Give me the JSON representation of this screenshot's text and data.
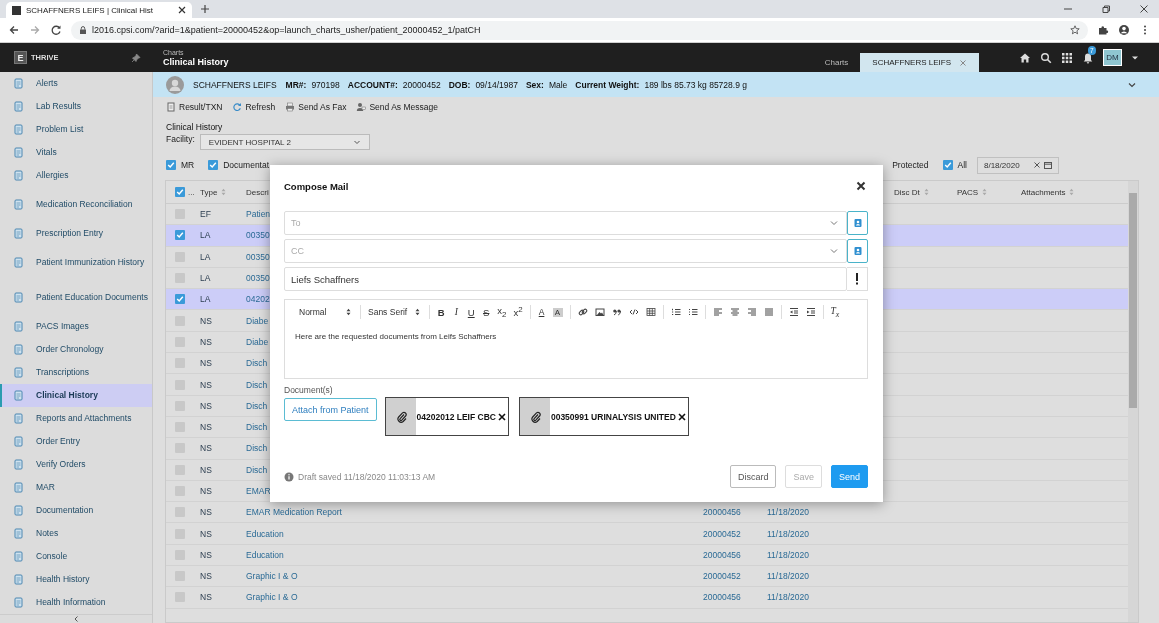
{
  "browser": {
    "tab_title": "SCHAFFNERS LEIFS | Clinical Hist",
    "url": "l2016.cpsi.com/?arid=1&patient=20000452&op=launch_charts_usher/patient_20000452_1/patCH"
  },
  "app": {
    "brand_logo": "E",
    "brand": "THRIVE",
    "breadcrumb": "Charts",
    "title": "Clinical History",
    "tabs": [
      {
        "label": "Charts",
        "selected": false
      },
      {
        "label": "SCHAFFNERS LEIFS",
        "selected": true
      }
    ],
    "notification_count": "7",
    "user_initials": "DM"
  },
  "sidebar": {
    "items": [
      {
        "label": "Alerts",
        "selected": false
      },
      {
        "label": "Lab Results",
        "selected": false
      },
      {
        "label": "Problem List",
        "selected": false
      },
      {
        "label": "Vitals",
        "selected": false
      },
      {
        "label": "Allergies",
        "selected": false
      },
      {
        "label": "Medication Reconciliation",
        "selected": false
      },
      {
        "label": "Prescription Entry",
        "selected": false
      },
      {
        "label": "Patient Immunization History",
        "selected": false
      },
      {
        "label": "Patient Education Documents",
        "selected": false
      },
      {
        "label": "PACS Images",
        "selected": false
      },
      {
        "label": "Order Chronology",
        "selected": false
      },
      {
        "label": "Transcriptions",
        "selected": false
      },
      {
        "label": "Clinical History",
        "selected": true
      },
      {
        "label": "Reports and Attachments",
        "selected": false
      },
      {
        "label": "Order Entry",
        "selected": false
      },
      {
        "label": "Verify Orders",
        "selected": false
      },
      {
        "label": "MAR",
        "selected": false
      },
      {
        "label": "Documentation",
        "selected": false
      },
      {
        "label": "Notes",
        "selected": false
      },
      {
        "label": "Console",
        "selected": false
      },
      {
        "label": "Health History",
        "selected": false
      },
      {
        "label": "Health Information",
        "selected": false
      }
    ]
  },
  "patient": {
    "name": "SCHAFFNERS LEIFS",
    "fields": [
      {
        "label": "MR#:",
        "value": "970198"
      },
      {
        "label": "ACCOUNT#:",
        "value": "20000452"
      },
      {
        "label": "DOB:",
        "value": "09/14/1987"
      },
      {
        "label": "Sex:",
        "value": "Male"
      },
      {
        "label": "Current Weight:",
        "value": "189 lbs 85.73 kg 85728.9 g"
      }
    ]
  },
  "toolbar": [
    "Result/TXN",
    "Refresh",
    "Send As Fax",
    "Send As Message"
  ],
  "history": {
    "title": "Clinical History",
    "facility_label": "Facility:",
    "facility": "EVIDENT HOSPITAL 2",
    "date": "8/18/2020",
    "filters": [
      {
        "kind": "checkbox",
        "label": "MR",
        "checked": true
      },
      {
        "kind": "checkbox",
        "label": "Documentat",
        "checked": true
      },
      {
        "kind": "label",
        "label": "Protected"
      },
      {
        "kind": "checkbox",
        "label": "All",
        "checked": true
      }
    ]
  },
  "table": {
    "select_all_checked": true,
    "select_all_label": "...",
    "columns": [
      {
        "label": "Type",
        "sortable": true
      },
      {
        "label": "Descri",
        "sortable": false
      },
      {
        "label": "Disc Dt",
        "sortable": true
      },
      {
        "label": "PACS",
        "sortable": true
      },
      {
        "label": "Attachments",
        "sortable": true
      }
    ],
    "rows": [
      {
        "selected": false,
        "type": "EF",
        "description": "Patien"
      },
      {
        "selected": true,
        "type": "LA",
        "description": "00350"
      },
      {
        "selected": false,
        "type": "LA",
        "description": "00350"
      },
      {
        "selected": false,
        "type": "LA",
        "description": "00350"
      },
      {
        "selected": true,
        "type": "LA",
        "description": "04202"
      },
      {
        "selected": false,
        "type": "NS",
        "description": "Diabe"
      },
      {
        "selected": false,
        "type": "NS",
        "description": "Diabe"
      },
      {
        "selected": false,
        "type": "NS",
        "description": "Disch"
      },
      {
        "selected": false,
        "type": "NS",
        "description": "Disch"
      },
      {
        "selected": false,
        "type": "NS",
        "description": "Disch"
      },
      {
        "selected": false,
        "type": "NS",
        "description": "Disch"
      },
      {
        "selected": false,
        "type": "NS",
        "description": "Disch"
      },
      {
        "selected": false,
        "type": "NS",
        "description": "Disch"
      },
      {
        "selected": false,
        "type": "NS",
        "description": "EMAR"
      },
      {
        "selected": false,
        "type": "NS",
        "description": "EMAR Medication Report",
        "account": "20000456",
        "date": "11/18/2020"
      },
      {
        "selected": false,
        "type": "NS",
        "description": "Education",
        "account": "20000452",
        "date": "11/18/2020"
      },
      {
        "selected": false,
        "type": "NS",
        "description": "Education",
        "account": "20000456",
        "date": "11/18/2020"
      },
      {
        "selected": false,
        "type": "NS",
        "description": "Graphic I & O",
        "account": "20000452",
        "date": "11/18/2020"
      },
      {
        "selected": false,
        "type": "NS",
        "description": "Graphic I & O",
        "account": "20000456",
        "date": "11/18/2020"
      }
    ]
  },
  "compose": {
    "title": "Compose Mail",
    "to_placeholder": "To",
    "cc_placeholder": "CC",
    "subject": "Liefs Schaffners",
    "format": "Normal",
    "font": "Sans Serif",
    "toolbar_groups": [
      [
        {
          "kind": "bold",
          "glyph": "B"
        },
        {
          "kind": "italic",
          "glyph": "I"
        },
        {
          "kind": "underline",
          "glyph": "U"
        },
        {
          "kind": "strike",
          "glyph": "S"
        },
        {
          "kind": "sub",
          "glyph": "x$_{2}$"
        },
        {
          "kind": "sup",
          "glyph": "x$^{2}$"
        }
      ],
      [
        {
          "kind": "color",
          "glyph": "A"
        },
        {
          "kind": "background",
          "glyph": "A"
        }
      ],
      [
        {
          "kind": "link"
        },
        {
          "kind": "image"
        },
        {
          "kind": "quote"
        },
        {
          "kind": "code"
        },
        {
          "kind": "table"
        }
      ],
      [
        {
          "kind": "ordered"
        },
        {
          "kind": "bullet"
        }
      ],
      [
        {
          "kind": "align-left"
        },
        {
          "kind": "align-center"
        },
        {
          "kind": "align-right"
        },
        {
          "kind": "justify"
        }
      ],
      [
        {
          "kind": "outdent"
        },
        {
          "kind": "indent"
        }
      ],
      [
        {
          "kind": "clean",
          "glyph": "T$_{x}$"
        }
      ]
    ],
    "body": "Here are the requested documents from Leifs Schaffners",
    "documents_label": "Document(s)",
    "attach_button": "Attach from Patient",
    "attachments": [
      {
        "name": "04202012 LEIF CBC"
      },
      {
        "name": "00350991 URINALYSIS UNITED"
      }
    ],
    "draft_status": "Draft saved 11/18/2020 11:03:13 AM",
    "buttons": [
      {
        "label": "Discard",
        "kind": "secondary",
        "disabled": false
      },
      {
        "label": "Save",
        "kind": "secondary",
        "disabled": true
      },
      {
        "label": "Send",
        "kind": "primary",
        "disabled": false
      }
    ]
  }
}
